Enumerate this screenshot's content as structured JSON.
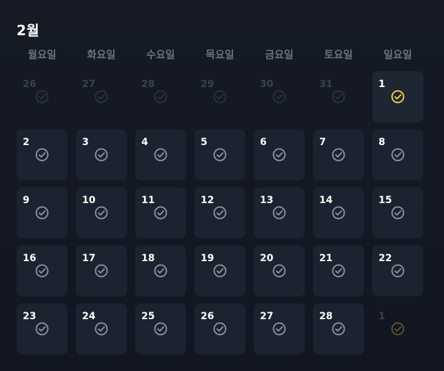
{
  "calendar": {
    "month_title": "2월",
    "weekdays": [
      "월요일",
      "화요일",
      "수요일",
      "목요일",
      "금요일",
      "토요일",
      "일요일"
    ],
    "colors": {
      "background": "#131722",
      "cell": "#1b2230",
      "check_default": "#8b93a1",
      "check_done": "#f5d742",
      "weekday_text": "#6b7280"
    },
    "weeks": [
      [
        {
          "day": "26",
          "state": "outside",
          "checked": false
        },
        {
          "day": "27",
          "state": "outside",
          "checked": false
        },
        {
          "day": "28",
          "state": "outside",
          "checked": false
        },
        {
          "day": "29",
          "state": "outside",
          "checked": false
        },
        {
          "day": "30",
          "state": "outside",
          "checked": false
        },
        {
          "day": "31",
          "state": "outside",
          "checked": false
        },
        {
          "day": "1",
          "state": "today",
          "checked": true
        }
      ],
      [
        {
          "day": "2",
          "state": "current",
          "checked": false
        },
        {
          "day": "3",
          "state": "current",
          "checked": false
        },
        {
          "day": "4",
          "state": "current",
          "checked": false
        },
        {
          "day": "5",
          "state": "current",
          "checked": false
        },
        {
          "day": "6",
          "state": "current",
          "checked": false
        },
        {
          "day": "7",
          "state": "current",
          "checked": false
        },
        {
          "day": "8",
          "state": "current",
          "checked": false
        }
      ],
      [
        {
          "day": "9",
          "state": "current",
          "checked": false
        },
        {
          "day": "10",
          "state": "current",
          "checked": false
        },
        {
          "day": "11",
          "state": "current",
          "checked": false
        },
        {
          "day": "12",
          "state": "current",
          "checked": false
        },
        {
          "day": "13",
          "state": "current",
          "checked": false
        },
        {
          "day": "14",
          "state": "current",
          "checked": false
        },
        {
          "day": "15",
          "state": "current",
          "checked": false
        }
      ],
      [
        {
          "day": "16",
          "state": "current",
          "checked": false
        },
        {
          "day": "17",
          "state": "current",
          "checked": false
        },
        {
          "day": "18",
          "state": "current",
          "checked": false
        },
        {
          "day": "19",
          "state": "current",
          "checked": false
        },
        {
          "day": "20",
          "state": "current",
          "checked": false
        },
        {
          "day": "21",
          "state": "current",
          "checked": false
        },
        {
          "day": "22",
          "state": "current",
          "checked": false
        }
      ],
      [
        {
          "day": "23",
          "state": "current",
          "checked": false
        },
        {
          "day": "24",
          "state": "current",
          "checked": false
        },
        {
          "day": "25",
          "state": "current",
          "checked": false
        },
        {
          "day": "26",
          "state": "current",
          "checked": false
        },
        {
          "day": "27",
          "state": "current",
          "checked": false
        },
        {
          "day": "28",
          "state": "current",
          "checked": false
        },
        {
          "day": "1",
          "state": "outside",
          "checked": true
        }
      ]
    ],
    "icons": {
      "check": "check-circle-icon"
    }
  }
}
